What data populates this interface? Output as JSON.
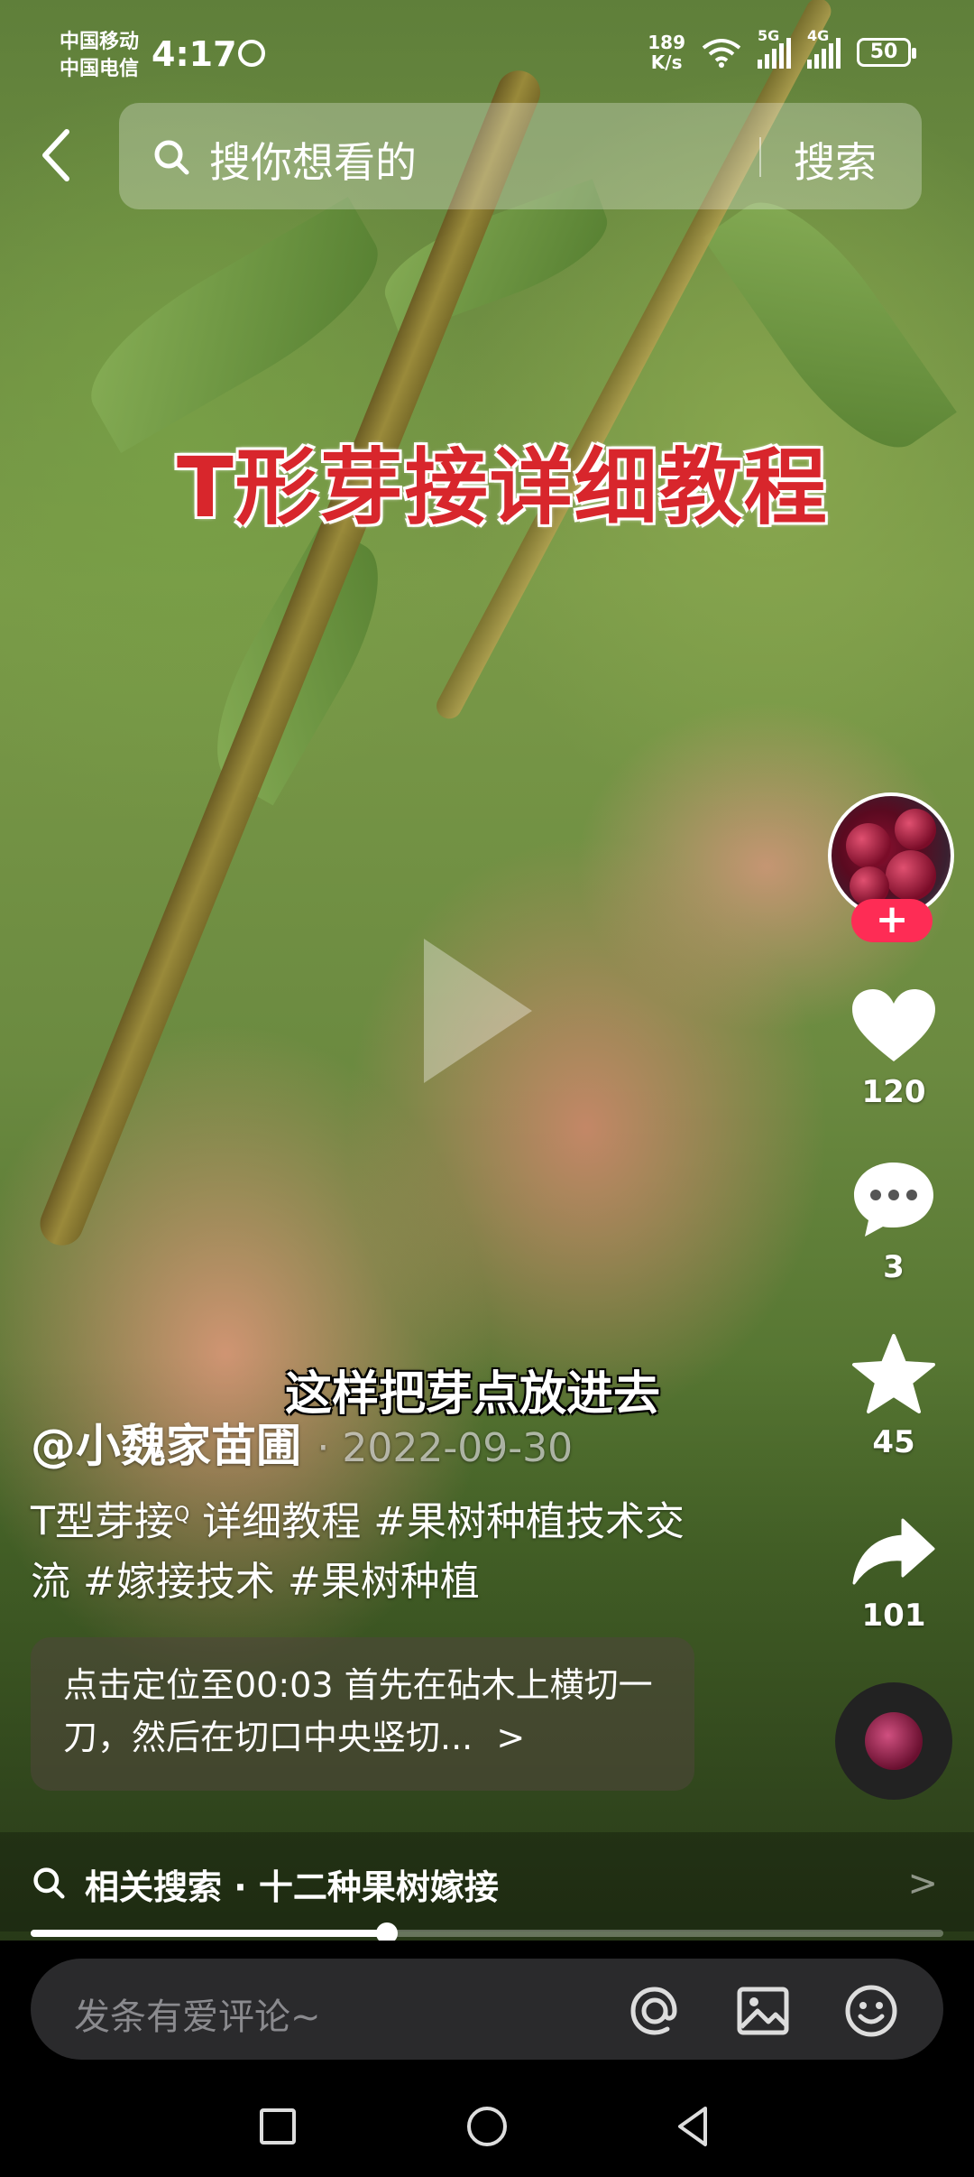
{
  "status_bar": {
    "carrier1": "中国移动",
    "carrier2": "中国电信",
    "time": "4:17",
    "net_speed_value": "189",
    "net_speed_unit": "K/s",
    "network1": "5G",
    "network2": "4G",
    "battery": "50"
  },
  "search": {
    "placeholder": "搜你想看的",
    "button_label": "搜索"
  },
  "video": {
    "title_overlay": "T形芽接详细教程",
    "subtitle": "这样把芽点放进去"
  },
  "rail": {
    "follow_label": "+",
    "likes": "120",
    "comments": "3",
    "favorites": "45",
    "shares": "101"
  },
  "post": {
    "author": "@小魏家苗圃",
    "date": "· 2022-09-30",
    "caption_part1": "T型芽接",
    "caption_search_mark": "Q",
    "caption_part2": " 详细教程 #果树种植技术交流 #嫁接技术 #果树种植",
    "chapter_text": "点击定位至00:03 首先在砧木上横切一刀，然后在切口中央竖切...",
    "chapter_chevron": ">"
  },
  "related": {
    "label": "相关搜索 · 十二种果树嫁接",
    "chevron": ">"
  },
  "progress": {
    "fraction": 0.39
  },
  "comment": {
    "placeholder": "发条有爱评论~"
  },
  "colors": {
    "accent": "#fe2c55",
    "title_red": "#d8262c"
  }
}
